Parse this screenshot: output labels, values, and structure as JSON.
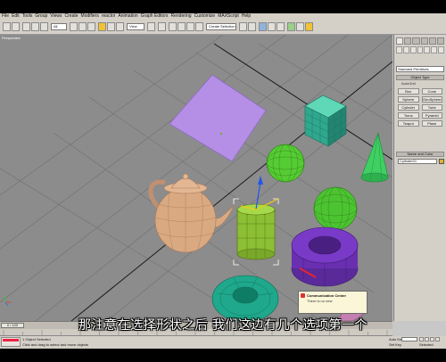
{
  "menu": {
    "items": [
      "File",
      "Edit",
      "Tools",
      "Group",
      "Views",
      "Create",
      "Modifiers",
      "reactor",
      "Animation",
      "Graph Editors",
      "Rendering",
      "Customize",
      "MAXScript",
      "Help"
    ]
  },
  "toolbar": {
    "selection_filter": "All",
    "reference_coord": "View",
    "named_selection": "Create Selection Set"
  },
  "viewport": {
    "label": "Perspective"
  },
  "command_panel": {
    "category_dropdown": "Standard Primitives",
    "object_type_header": "Object Type",
    "autogrid_label": "AutoGrid",
    "object_buttons": [
      "Box",
      "Cone",
      "Sphere",
      "GeoSphere",
      "Cylinder",
      "Tube",
      "Torus",
      "Pyramid",
      "Teapot",
      "Plane"
    ],
    "name_color_header": "Name and Color",
    "name_value": "Cylinder01",
    "swatch_color": "#e3b12a"
  },
  "timeline": {
    "slider_label": "0 / 100"
  },
  "status": {
    "selected_text": "1 Object Selected",
    "prompt_text": "Click and drag to select and move objects",
    "auto_key": "Auto Key",
    "set_key": "Set Key",
    "selected_mode": "Selected"
  },
  "communication_center": {
    "title": "Communication Center",
    "subtitle": "There is no new"
  },
  "subtitle": {
    "text": "那注意在选择形状之后 我们这边有几个选项第一个"
  },
  "colors": {
    "viewport_bg": "#8c8c8c",
    "grid_line": "#6f6f6f",
    "plane": "#b58fe6",
    "box": "#2fa88e",
    "sphere": "#55cc33",
    "cone": "#3fcf63",
    "teapot": "#d9a981",
    "cylinder": "#8cbf33",
    "tube": "#6a2fb0",
    "torus": "#1fa88c"
  }
}
